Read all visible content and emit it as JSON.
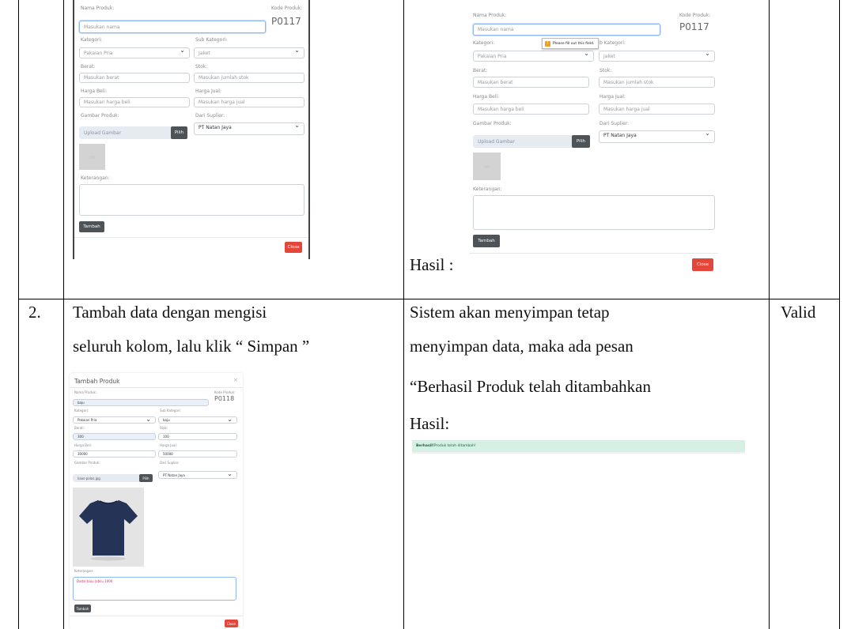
{
  "top_left": {
    "nama_label": "Nama Produk:",
    "nama_placeholder": "Masukan nama",
    "kode_label": "Kode Produk:",
    "kode_value": "P0117",
    "kategori_label": "Kategori:",
    "kategori_value": "Pakaian Pria",
    "sub_label": "Sub Kategori:",
    "sub_value": "Jaket",
    "berat_label": "Berat:",
    "berat_placeholder": "Masukan berat",
    "stok_label": "Stok:",
    "stok_placeholder": "Masukan jumlah stok",
    "beli_label": "Harga Beli:",
    "beli_placeholder": "Masukan harga beli",
    "jual_label": "Harga Jual:",
    "jual_placeholder": "Masukan harga jual",
    "gambar_label": "Gambar Produk:",
    "upload_label": "Upload Gambar",
    "pilih_label": "Pilih",
    "suplier_label": "Dari Suplier:",
    "suplier_value": "PT Natan Jaya",
    "ket_label": "Keterangan:",
    "tambah_label": "Tambah",
    "close_label": "Close"
  },
  "top_right": {
    "nama_label": "Nama Produk:",
    "nama_placeholder": "Masukan nama",
    "kode_label": "Kode Produk:",
    "kode_value": "P0117",
    "kategori_label": "Kategori:",
    "kategori_value": "Pakaian Pria",
    "sub_label": "Sub Kategori:",
    "sub_label_partial": "b Kategori:",
    "sub_value": "Jaket",
    "tooltip": "Please fill out this field.",
    "berat_label": "Berat:",
    "berat_placeholder": "Masukan berat",
    "stok_label": "Stok:",
    "stok_placeholder": "Masukan jumlah stok",
    "beli_label": "Harga Beli:",
    "beli_placeholder": "Masukan harga beli",
    "jual_label": "Harga Jual:",
    "jual_placeholder": "Masukan harga jual",
    "gambar_label": "Gambar Produk:",
    "upload_label": "Upload Gambar",
    "pilih_label": "Pilih",
    "suplier_label": "Dari Suplier:",
    "suplier_value": "PT Natan Jaya",
    "ket_label": "Keterangan:",
    "tambah_label": "Tambah",
    "close_label": "Close",
    "hasil_label": "Hasil :"
  },
  "row2": {
    "number": "2.",
    "scenario_line1": "Tambah data dengan mengisi",
    "scenario_line2": "seluruh kolom, lalu  klik “ Simpan ”",
    "expected_line1": "Sistem  akan  menyimpan tetap",
    "expected_line2": "menyimpan data, maka  ada  pesan",
    "expected_line3": "“Berhasil  Produk  telah  ditambahkan",
    "hasil_label": "Hasil:",
    "conclusion": "Valid",
    "alert_bold": "Berhasil!",
    "alert_text": " Produk telah ditambah!"
  },
  "bottom_form": {
    "title": "Tambah Produk",
    "close_x": "×",
    "nama_label": "Nama Produk:",
    "nama_value": "baju",
    "kode_label": "Kode Produk:",
    "kode_value": "P0118",
    "kategori_label": "Kategori:",
    "kategori_value": "Pakaian Pria",
    "sub_label": "Sub Kategori:",
    "sub_value": "baju",
    "berat_label": "Berat:",
    "berat_value": "300",
    "stok_label": "Stok:",
    "stok_value": "100",
    "beli_label": "Harga Beli:",
    "beli_value": "30000",
    "jual_label": "Harga Jual:",
    "jual_value": "50000",
    "gambar_label": "Gambar Produk:",
    "file_value": "kaos-polos.jpg",
    "pilih_label": "Pilih",
    "suplier_label": "Dari Suplier:",
    "suplier_value": "PT Natan Jaya",
    "ket_label": "Keterangan:",
    "ket_value": "Dadal baju |abcu 1000",
    "tambah_label": "Tambah",
    "close_label": "Close"
  }
}
